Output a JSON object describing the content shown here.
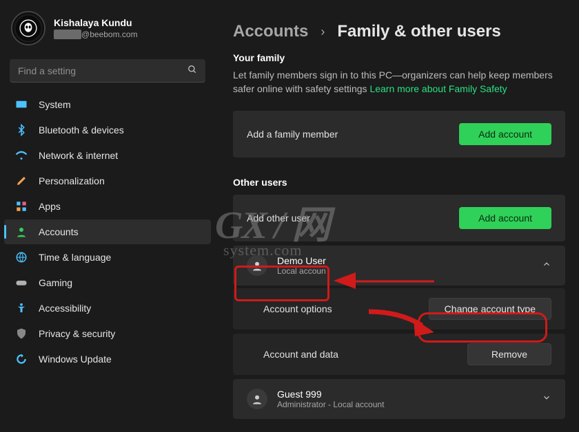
{
  "user": {
    "name": "Kishalaya Kundu",
    "email_domain": "@beebom.com"
  },
  "search": {
    "placeholder": "Find a setting"
  },
  "sidebar": {
    "items": [
      {
        "label": "System"
      },
      {
        "label": "Bluetooth & devices"
      },
      {
        "label": "Network & internet"
      },
      {
        "label": "Personalization"
      },
      {
        "label": "Apps"
      },
      {
        "label": "Accounts"
      },
      {
        "label": "Time & language"
      },
      {
        "label": "Gaming"
      },
      {
        "label": "Accessibility"
      },
      {
        "label": "Privacy & security"
      },
      {
        "label": "Windows Update"
      }
    ]
  },
  "breadcrumb": {
    "parent": "Accounts",
    "current": "Family & other users"
  },
  "family": {
    "title": "Your family",
    "desc_prefix": "Let family members sign in to this PC—organizers can help keep members safer online with safety settings  ",
    "link": "Learn more about Family Safety",
    "add_label": "Add a family member",
    "add_button": "Add account"
  },
  "other": {
    "title": "Other users",
    "add_label": "Add other user",
    "add_button": "Add account",
    "demo": {
      "name": "Demo User",
      "role": "Local accoun"
    },
    "opt_label": "Account options",
    "opt_button": "Change account type",
    "data_label": "Account and data",
    "data_button": "Remove",
    "guest": {
      "name": "Guest 999",
      "role": "Administrator - Local account"
    }
  },
  "watermark": {
    "main": "GX / 网",
    "sub": "system.com"
  }
}
